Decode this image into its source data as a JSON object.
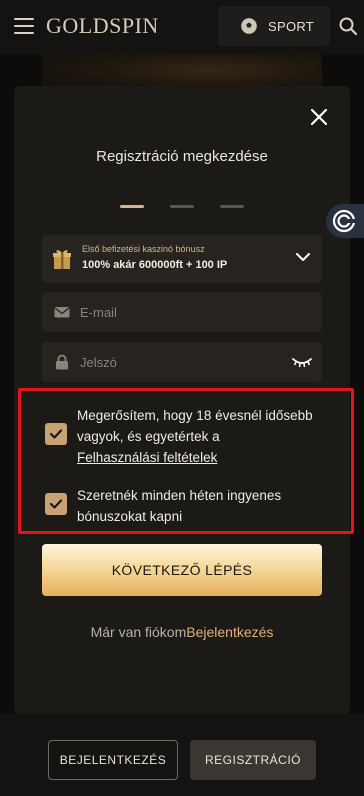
{
  "header": {
    "logo_text": "GOLDSPIN",
    "sport_label": "SPORT"
  },
  "modal": {
    "title": "Regisztráció megkezdése",
    "steps_total": 3,
    "active_step": 1,
    "bonus": {
      "label": "Első befizetési kaszinó bónusz",
      "value": "100% akár 600000ft + 100 IP"
    },
    "email_placeholder": "E-mail",
    "password_placeholder": "Jelszó",
    "consent_age": {
      "text": "Megerősítem, hogy 18 évesnél idősebb vagyok, és egyetértek a",
      "link": "Felhasználási feltételek",
      "checked": true
    },
    "consent_bonus": {
      "text": "Szeretnék minden héten ingyenes bónuszokat kapni",
      "checked": true
    },
    "next_button": "KÖVETKEZŐ LÉPÉS",
    "have_account_text": "Már van fiókom",
    "login_link": "Bejelentkezés"
  },
  "bottom_bar": {
    "login_button": "BEJELENTKEZÉS",
    "register_button": "REGISZTRÁCIÓ"
  },
  "colors": {
    "accent": "#d9b48a",
    "highlight_border": "#e3141b",
    "button_gradient_top": "#fff6d8",
    "button_gradient_bottom": "#e7ae5e"
  },
  "icons": [
    "hamburger-icon",
    "soccer-ball-icon",
    "search-icon",
    "close-icon",
    "gift-icon",
    "chevron-down-icon",
    "mail-icon",
    "lock-icon",
    "eye-closed-icon",
    "check-icon",
    "support-icon"
  ]
}
